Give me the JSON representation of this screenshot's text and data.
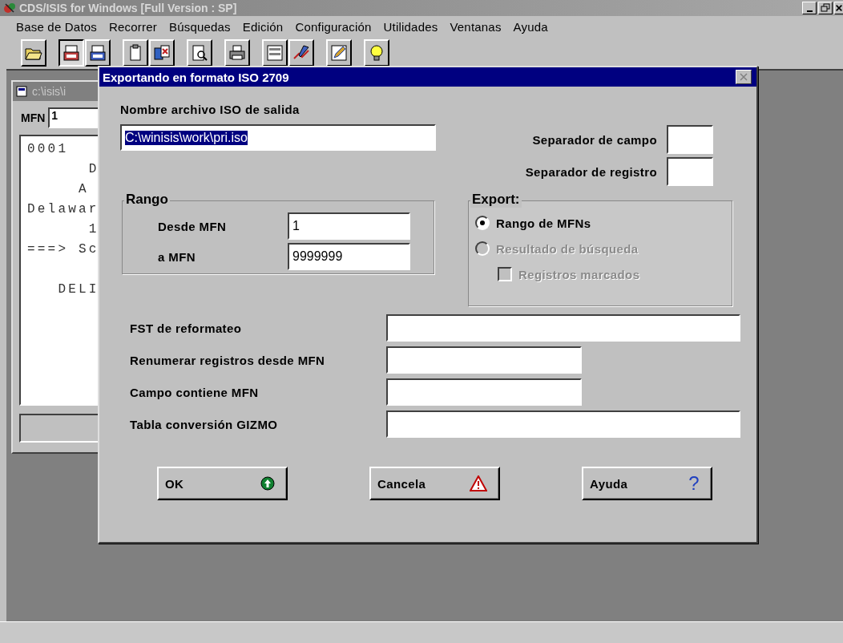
{
  "app": {
    "title": "CDS/ISIS for Windows [Full Version : SP]",
    "active": false
  },
  "menu": [
    "Base de Datos",
    "Recorrer",
    "Búsquedas",
    "Edición",
    "Configuración",
    "Utilidades",
    "Ventanas",
    "Ayuda"
  ],
  "toolbar": [
    [
      {
        "kind": "folder",
        "pressed": false
      }
    ],
    [
      {
        "kind": "txt",
        "pressed": true
      },
      {
        "kind": "etf",
        "pressed": false
      }
    ],
    [
      {
        "kind": "clipboard",
        "pressed": false
      },
      {
        "kind": "copy",
        "pressed": false
      }
    ],
    [
      {
        "kind": "preview",
        "pressed": false
      }
    ],
    [
      {
        "kind": "printer",
        "pressed": false
      }
    ],
    [
      {
        "kind": "form",
        "pressed": false
      },
      {
        "kind": "chart",
        "pressed": false
      }
    ],
    [
      {
        "kind": "pencil",
        "pressed": false
      }
    ],
    [
      {
        "kind": "bulb",
        "pressed": false
      }
    ]
  ],
  "child_window": {
    "title": "c:\\isis\\i",
    "mfn_label": "MFN",
    "mfn_value": "1",
    "line_blocks": [
      [
        "0001",
        "      D",
        "     A",
        "Delawar",
        "      1",
        "===> Sc"
      ],
      [
        "   DELI"
      ]
    ]
  },
  "dialog": {
    "title": "Exportando en formato ISO 2709",
    "file_label": "Nombre archivo ISO de salida",
    "file_value": "C:\\winisis\\work\\pri.iso",
    "file_value_selected": true,
    "separators": [
      {
        "label": "Separador de campo"
      },
      {
        "label": "Separador de registro"
      }
    ],
    "range": {
      "title": "Rango",
      "from_label": "Desde MFN",
      "from_value": "1",
      "to_label": "a MFN",
      "to_value": "9999999"
    },
    "export": {
      "title": "Export:",
      "options": [
        {
          "label": "Rango de MFNs",
          "selected": true,
          "disabled": false
        },
        {
          "label": "Resultado de búsqueda",
          "selected": false,
          "disabled": true
        }
      ],
      "marked": {
        "label": "Registros marcados",
        "checked": false,
        "disabled": true
      }
    },
    "fields": [
      {
        "label": "FST de reformateo",
        "kind": "wide"
      },
      {
        "label": "Renumerar registros desde MFN",
        "kind": "short"
      },
      {
        "label": "Campo contiene MFN",
        "kind": "short"
      },
      {
        "label": "Tabla conversión GIZMO",
        "kind": "wide"
      }
    ],
    "buttons": [
      {
        "label": "OK",
        "kind": "ok"
      },
      {
        "label": "Cancela",
        "kind": "cancel"
      },
      {
        "label": "Ayuda",
        "kind": "help",
        "icon": "?"
      }
    ]
  }
}
